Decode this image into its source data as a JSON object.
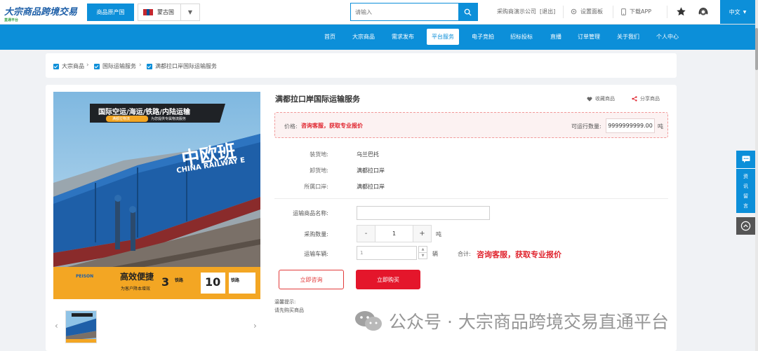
{
  "header": {
    "logo_text": "大宗商品跨境交易",
    "logo_sub": "直通平台",
    "origin_button": "商品原产国",
    "country": "蒙古国",
    "flag_colors": [
      "#c4272f",
      "#015197",
      "#c4272f"
    ],
    "search_placeholder": "请输入",
    "company": "采购商演示公司",
    "logout": "[退出]",
    "settings": "设置面板",
    "download": "下载APP",
    "language": "中文"
  },
  "nav": {
    "items": [
      "首页",
      "大宗商品",
      "需求发布",
      "平台服务",
      "电子竞拍",
      "招标投标",
      "直播",
      "订单管理",
      "关于我们",
      "个人中心"
    ],
    "active_index": 3
  },
  "breadcrumb": [
    "大宗商品",
    "国际运输服务",
    "满都拉口岸国际运输服务"
  ],
  "product": {
    "title": "满都拉口岸国际运输服务",
    "favorite": "收藏商品",
    "share": "分享商品",
    "price_label": "价格:",
    "price_value": "咨询客服，获取专业报价",
    "qty_label": "可运行数量:",
    "qty_value": "9999999999.00",
    "qty_unit": "吨",
    "image": {
      "banner_title": "国际空运/海运/铁路/内陆运输",
      "banner_sub1": "满都拉物流",
      "banner_sub2": "为您提供专属物流服务",
      "train_brand": "中欧班",
      "train_brand_en": "CHINA RAILWAY E",
      "logo": "PEISON",
      "slogan": "高效便捷",
      "slogan_sub": "为客户降本增效",
      "badge1_num": "3",
      "badge1_label": "铁路",
      "badge2_num": "10",
      "badge2_label": "铁路"
    }
  },
  "info": [
    {
      "label": "装货地:",
      "value": "乌兰巴托"
    },
    {
      "label": "卸货地:",
      "value": "满都拉口岸"
    },
    {
      "label": "所属口岸:",
      "value": "满都拉口岸"
    }
  ],
  "form": {
    "name_label": "运输商品名称:",
    "purchase_label": "采购数量:",
    "purchase_value": "1",
    "purchase_unit": "吨",
    "minus": "-",
    "plus": "+",
    "vehicle_label": "运输车辆:",
    "vehicle_value": "1",
    "vehicle_unit": "辆",
    "total_label": "合计:",
    "total_value": "咨询客服，获取专业报价"
  },
  "buttons": {
    "consult": "立即咨询",
    "buy": "立即购买"
  },
  "tips": {
    "title": "温馨提示:",
    "text": "请先购买商品"
  },
  "watermark": "公众号 · 大宗商品跨境交易直通平台",
  "side": {
    "chars": [
      "资",
      "讯",
      "留",
      "言"
    ]
  },
  "colors": {
    "primary": "#0c8fd9",
    "price_red": "#e0242e",
    "buy_red": "#e4162b"
  }
}
